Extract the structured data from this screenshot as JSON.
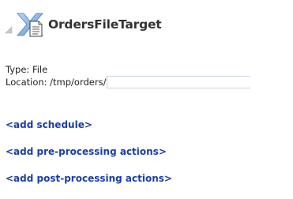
{
  "target": {
    "name": "OrdersFileTarget",
    "icon": "file-target-icon",
    "expander_icon": "triangle-expanded-icon"
  },
  "properties": {
    "type_label": "Type:",
    "type_value": "File",
    "location_label": "Location:",
    "location_value": "/tmp/orders/",
    "location_input_value": ""
  },
  "links": {
    "add_schedule": "<add schedule>",
    "add_pre_processing": "<add pre-processing actions>",
    "add_post_processing": "<add post-processing actions>"
  },
  "colors": {
    "link": "#1a3fa8",
    "title": "#333333",
    "icon_blue": "#2e6fb8"
  }
}
